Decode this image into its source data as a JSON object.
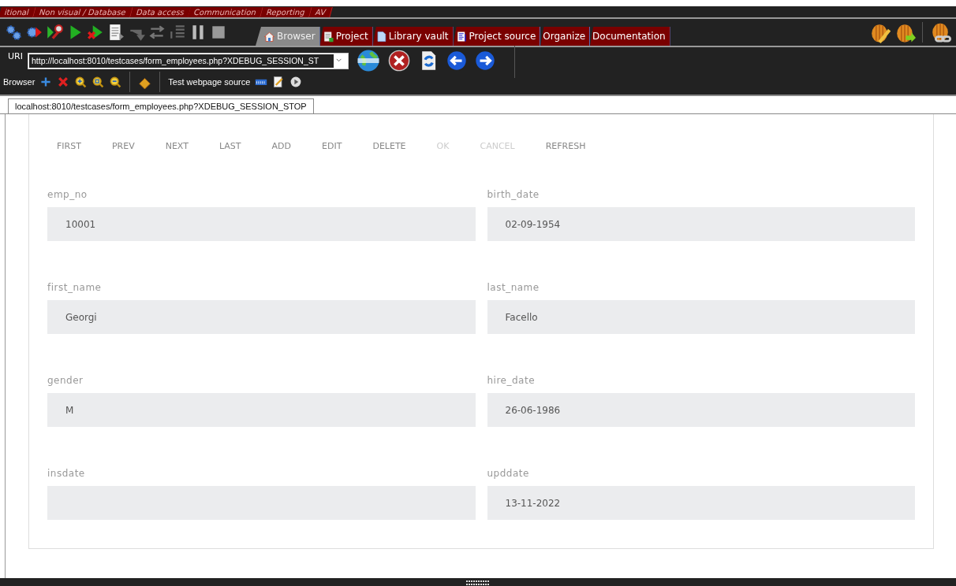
{
  "palette_tabs": [
    {
      "label": "itional"
    },
    {
      "label": "Non visual / Database"
    },
    {
      "label": "Data access"
    },
    {
      "label": "Communication"
    },
    {
      "label": "Reporting"
    },
    {
      "label": "AV"
    }
  ],
  "view_tabs": [
    {
      "label": "Browser",
      "selected": true
    },
    {
      "label": "Project",
      "selected": false
    },
    {
      "label": "Library vault",
      "selected": false
    },
    {
      "label": "Project source",
      "selected": false
    },
    {
      "label": "Organize",
      "selected": false
    },
    {
      "label": "Documentation",
      "selected": false
    }
  ],
  "uri": {
    "label": "URI",
    "value": "http://localhost:8010/testcases/form_employees.php?XDEBUG_SESSION_ST"
  },
  "browser_toolbar": {
    "label": "Browser",
    "source_label": "Test webpage source"
  },
  "document_tab": {
    "label": "localhost:8010/testcases/form_employees.php?XDEBUG_SESSION_STOP",
    "selected": true
  },
  "form": {
    "buttons": [
      {
        "label": "FIRST",
        "disabled": false
      },
      {
        "label": "PREV",
        "disabled": false
      },
      {
        "label": "NEXT",
        "disabled": false
      },
      {
        "label": "LAST",
        "disabled": false
      },
      {
        "label": "ADD",
        "disabled": false
      },
      {
        "label": "EDIT",
        "disabled": false
      },
      {
        "label": "DELETE",
        "disabled": false
      },
      {
        "label": "OK",
        "disabled": true
      },
      {
        "label": "CANCEL",
        "disabled": true
      },
      {
        "label": "REFRESH",
        "disabled": false
      }
    ],
    "fields": [
      {
        "label": "emp_no",
        "value": "10001"
      },
      {
        "label": "birth_date",
        "value": "02-09-1954"
      },
      {
        "label": "first_name",
        "value": "Georgi"
      },
      {
        "label": "last_name",
        "value": "Facello"
      },
      {
        "label": "gender",
        "value": "M"
      },
      {
        "label": "hire_date",
        "value": "26-06-1986"
      },
      {
        "label": "insdate"
      },
      {
        "label": "upddate",
        "value": "13-11-2022"
      }
    ]
  }
}
